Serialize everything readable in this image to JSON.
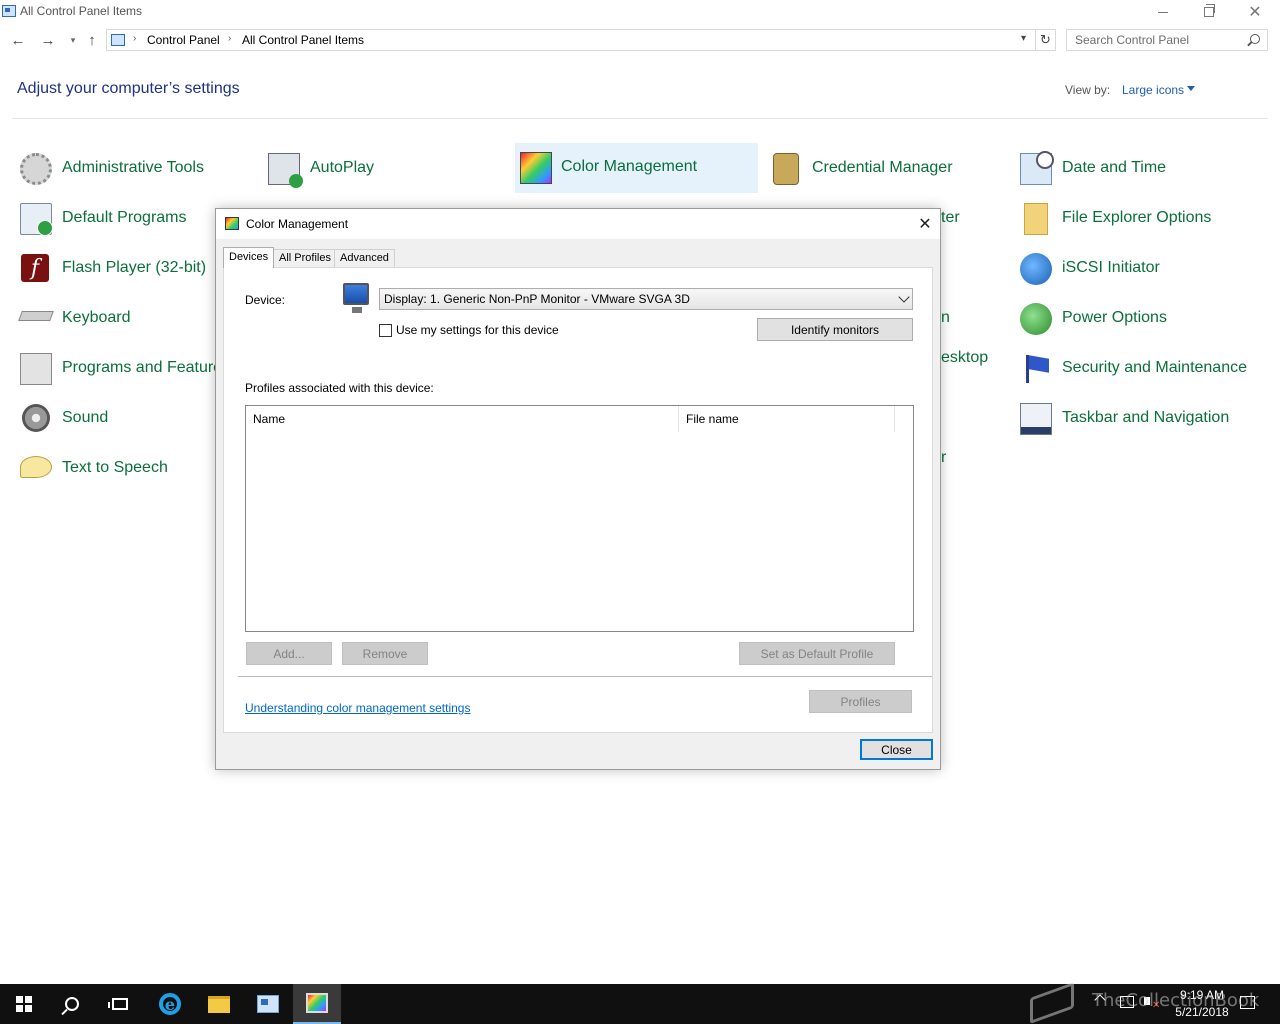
{
  "window": {
    "title": "All Control Panel Items",
    "controls": {
      "minimize": "—",
      "maximize": "❐",
      "close": "✕"
    }
  },
  "address": {
    "breadcrumbs": [
      "Control Panel",
      "All Control Panel Items"
    ],
    "search_placeholder": "Search Control Panel"
  },
  "header": {
    "title": "Adjust your computer’s settings",
    "view_by_label": "View by:",
    "view_by_value": "Large icons"
  },
  "items": [
    {
      "label": "Administrative Tools",
      "icon": "admin-tools-icon"
    },
    {
      "label": "AutoPlay",
      "icon": "autoplay-icon"
    },
    {
      "label": "Color Management",
      "icon": "color-management-icon"
    },
    {
      "label": "Credential Manager",
      "icon": "credential-manager-icon"
    },
    {
      "label": "Date and Time",
      "icon": "date-time-icon"
    },
    {
      "label": "Default Programs",
      "icon": "default-programs-icon"
    },
    {
      "label": "ter",
      "icon": "hidden"
    },
    {
      "label": "File Explorer Options",
      "icon": "file-explorer-options-icon"
    },
    {
      "label": "Flash Player (32-bit)",
      "icon": "flash-player-icon"
    },
    {
      "label": "iSCSI Initiator",
      "icon": "iscsi-initiator-icon"
    },
    {
      "label": "Keyboard",
      "icon": "keyboard-icon"
    },
    {
      "label": "n",
      "icon": "hidden"
    },
    {
      "label": "Power Options",
      "icon": "power-options-icon"
    },
    {
      "label": "Programs and Features",
      "icon": "programs-features-icon"
    },
    {
      "label": "esktop",
      "icon": "hidden"
    },
    {
      "label": "Security and Maintenance",
      "icon": "security-maintenance-icon"
    },
    {
      "label": "Sound",
      "icon": "sound-icon"
    },
    {
      "label": "Taskbar and Navigation",
      "icon": "taskbar-navigation-icon"
    },
    {
      "label": "Text to Speech",
      "icon": "text-to-speech-icon"
    },
    {
      "label": "r",
      "icon": "hidden"
    }
  ],
  "dialog": {
    "title": "Color Management",
    "close_glyph": "✕",
    "tabs": [
      "Devices",
      "All Profiles",
      "Advanced"
    ],
    "active_tab": "Devices",
    "device_label": "Device:",
    "device_value": "Display: 1. Generic Non-PnP Monitor - VMware SVGA 3D",
    "use_settings_label": "Use my settings for this device",
    "use_settings_checked": false,
    "identify_button": "Identify monitors",
    "profiles_label": "Profiles associated with this device:",
    "columns": [
      "Name",
      "File name"
    ],
    "add_button": "Add...",
    "remove_button": "Remove",
    "set_default_button": "Set as Default Profile",
    "help_link": "Understanding color management settings",
    "profiles_button": "Profiles",
    "close_button": "Close"
  },
  "taskbar": {
    "time": "9:19 AM",
    "date": "5/21/2018"
  },
  "watermark": "TheCollectionBook"
}
